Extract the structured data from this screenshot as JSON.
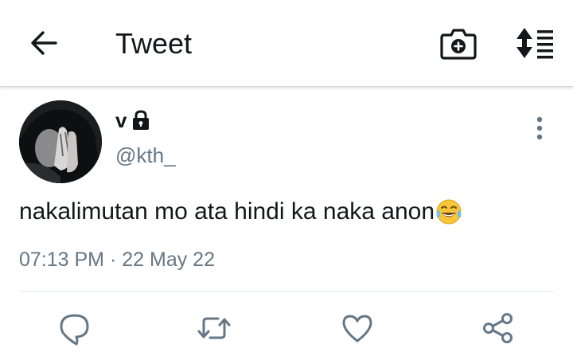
{
  "header": {
    "title": "Tweet",
    "back_icon": "arrow-left-icon",
    "camera_icon": "camera-add-icon",
    "sort_icon": "sort-list-icon"
  },
  "tweet": {
    "display_name": "v",
    "protected_icon": "lock-icon",
    "handle": "@kth_",
    "text": "nakalimutan mo ata hindi ka naka anon",
    "emoji": "face-with-tears-of-joy",
    "time": "07:13 PM",
    "separator": " · ",
    "date": "22 May 22",
    "more_icon": "more-vertical-icon"
  },
  "actions": {
    "reply_icon": "reply-bubble-icon",
    "retweet_icon": "retweet-icon",
    "like_icon": "heart-icon",
    "share_icon": "share-icon"
  },
  "colors": {
    "text": "#14171a",
    "secondary": "#657786",
    "divider": "#e1e8ed"
  }
}
